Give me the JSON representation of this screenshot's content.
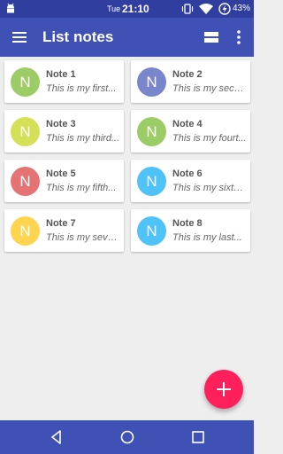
{
  "status_bar": {
    "day": "Tue",
    "time": "21:10",
    "battery": "43%",
    "icons": [
      "android-icon",
      "vibrate-icon",
      "wifi-icon",
      "battery-charging-icon"
    ]
  },
  "app_bar": {
    "title": "List notes",
    "icons": [
      "menu-icon",
      "view-list-icon",
      "more-vert-icon"
    ]
  },
  "notes": [
    {
      "initial": "N",
      "title": "Note 1",
      "body": "This is my first...",
      "color": "#9ccc65"
    },
    {
      "initial": "N",
      "title": "Note 2",
      "body": "This is my seco...",
      "color": "#7986cb"
    },
    {
      "initial": "N",
      "title": "Note 3",
      "body": "This is my third...",
      "color": "#d4e157"
    },
    {
      "initial": "N",
      "title": "Note 4",
      "body": "This is my fourt...",
      "color": "#9ccc65"
    },
    {
      "initial": "N",
      "title": "Note 5",
      "body": "This is my fifth...",
      "color": "#e57373"
    },
    {
      "initial": "N",
      "title": "Note 6",
      "body": "This is my sixth...",
      "color": "#4fc3f7"
    },
    {
      "initial": "N",
      "title": "Note 7",
      "body": "This is my seve...",
      "color": "#ffd54f"
    },
    {
      "initial": "N",
      "title": "Note 8",
      "body": "This is my last...",
      "color": "#4fc3f7"
    }
  ],
  "fab": {
    "icon": "add-icon",
    "color": "#ff1f5a"
  },
  "nav_bar": {
    "icons": [
      "back-icon",
      "home-icon",
      "recents-icon"
    ]
  },
  "colors": {
    "primary": "#3f51b5",
    "primary_dark": "#303f9f",
    "background": "#eeeeee"
  }
}
